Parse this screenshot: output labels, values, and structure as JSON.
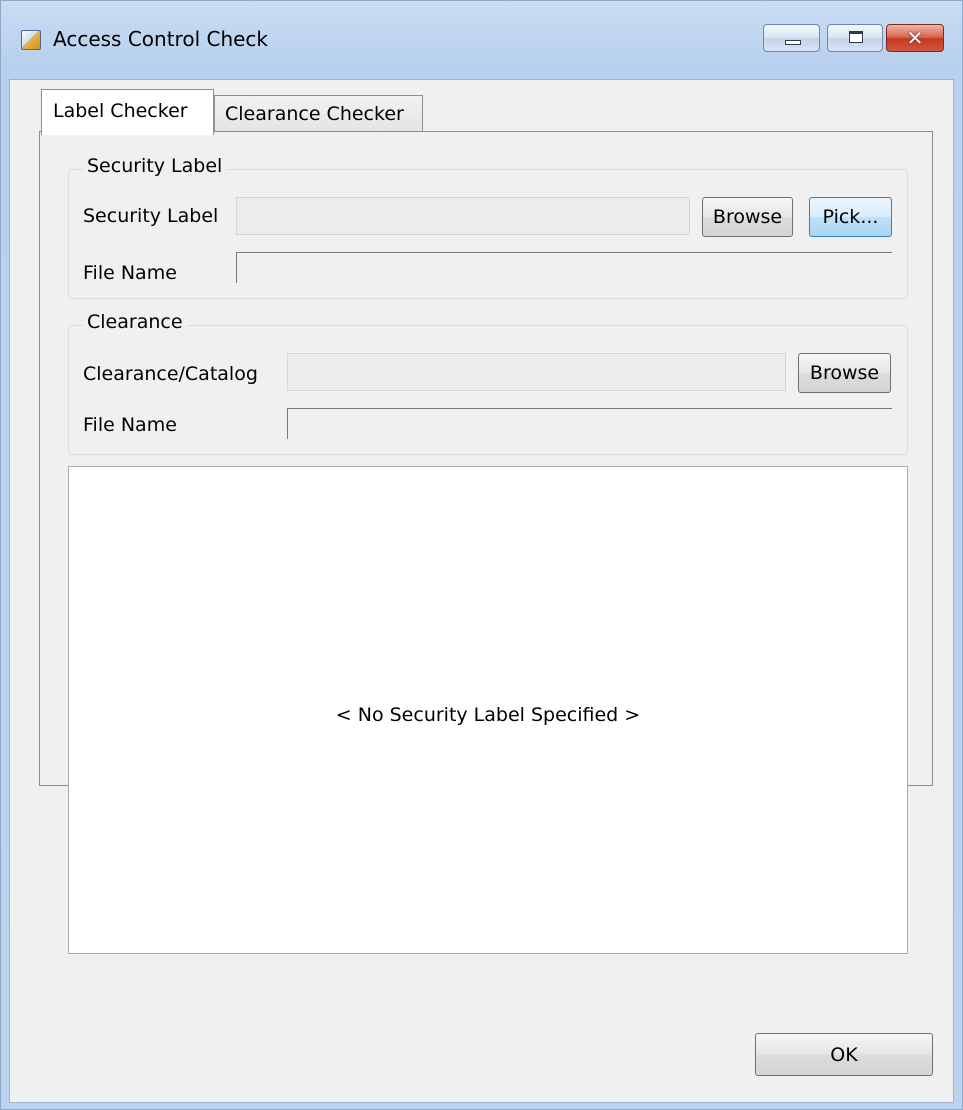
{
  "window": {
    "title": "Access Control Check",
    "icon": "app-icon",
    "controls": {
      "minimize": "minimize-icon",
      "maximize": "maximize-icon",
      "close": "✕"
    }
  },
  "tabs": [
    {
      "label": "Label Checker",
      "active": true
    },
    {
      "label": "Clearance Checker",
      "active": false
    }
  ],
  "security_label_group": {
    "legend": "Security Label",
    "label_field": {
      "label": "Security Label",
      "value": ""
    },
    "file_name": {
      "label": "File Name",
      "value": ""
    },
    "browse_label": "Browse",
    "pick_label": "Pick..."
  },
  "clearance_group": {
    "legend": "Clearance",
    "catalog_field": {
      "label": "Clearance/Catalog",
      "value": ""
    },
    "file_name": {
      "label": "File Name",
      "value": ""
    },
    "browse_label": "Browse"
  },
  "output": {
    "message": "< No Security Label Specified >"
  },
  "footer": {
    "ok_label": "OK"
  }
}
